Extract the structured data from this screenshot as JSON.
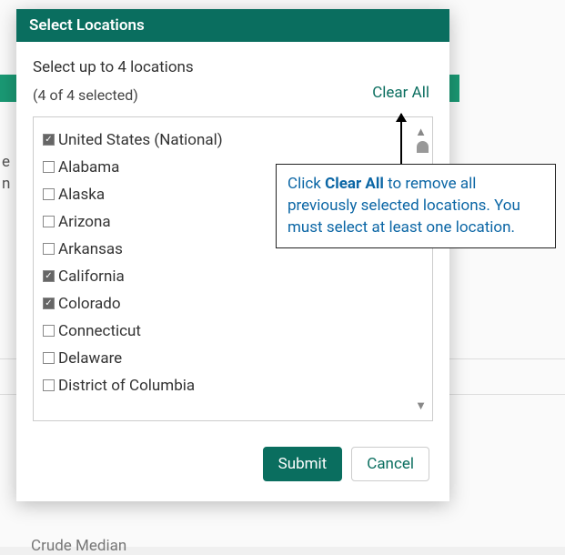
{
  "modal": {
    "title": "Select Locations",
    "instruction": "Select up to 4 locations",
    "selection_count": "(4 of 4 selected)",
    "clear_all": "Clear All"
  },
  "locations": [
    {
      "label": "United States (National)",
      "checked": true
    },
    {
      "label": "Alabama",
      "checked": false
    },
    {
      "label": "Alaska",
      "checked": false
    },
    {
      "label": "Arizona",
      "checked": false
    },
    {
      "label": "Arkansas",
      "checked": false
    },
    {
      "label": "California",
      "checked": true
    },
    {
      "label": "Colorado",
      "checked": true
    },
    {
      "label": "Connecticut",
      "checked": false
    },
    {
      "label": "Delaware",
      "checked": false
    },
    {
      "label": "District of Columbia",
      "checked": false
    }
  ],
  "footer": {
    "submit": "Submit",
    "cancel": "Cancel"
  },
  "callout": {
    "prefix": "Click ",
    "bold": "Clear All",
    "suffix": " to remove all previously selected locations. You must select at least one location."
  },
  "background": {
    "left_frag_1": "e",
    "left_frag_2": "n",
    "bottom_text": "Crude Median"
  }
}
